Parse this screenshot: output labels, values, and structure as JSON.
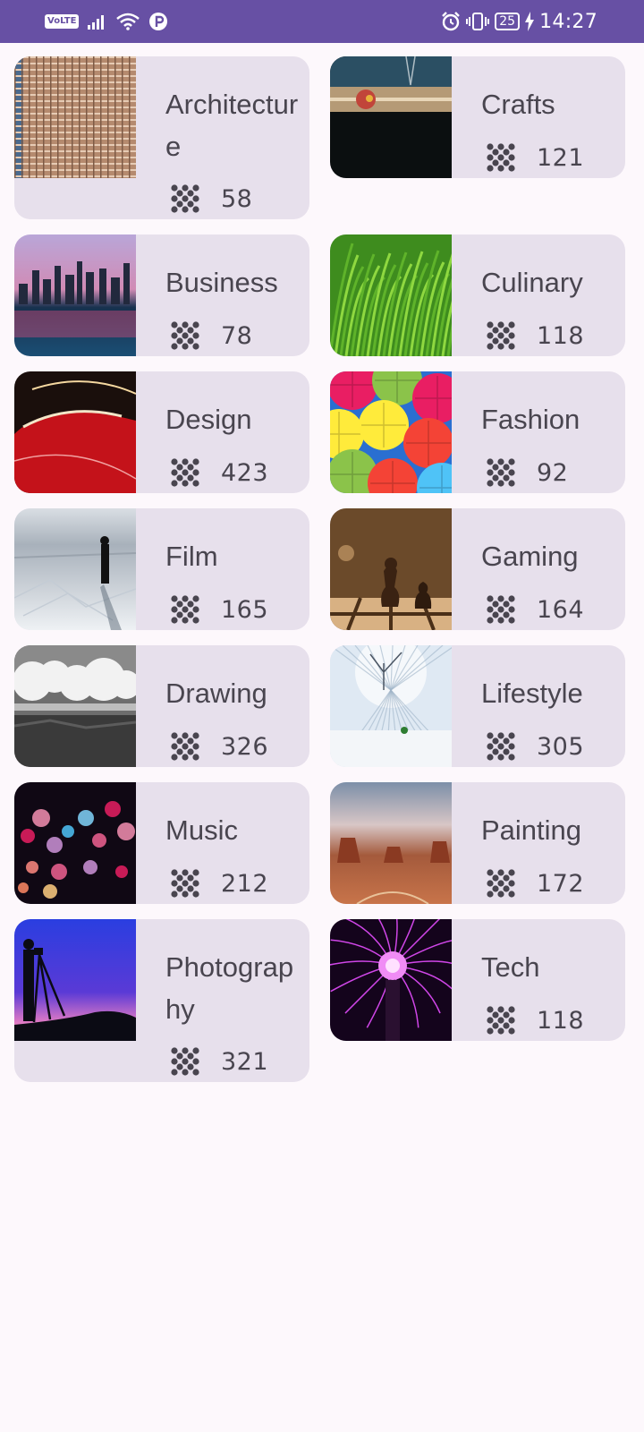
{
  "status_bar": {
    "network_badge": "VoLTE",
    "battery_level": "25",
    "time": "14:27",
    "icons": [
      "signal-icon",
      "wifi-icon",
      "data-saver-icon",
      "alarm-icon",
      "vibrate-icon",
      "battery-icon",
      "charging-icon"
    ]
  },
  "theme": {
    "primary": "#6750A4",
    "card": "#E7E0EC",
    "text": "#49454F",
    "background": "#FDF8FC"
  },
  "categories": [
    {
      "label": "Architecture",
      "count": "58",
      "icon": "dots-grid-icon"
    },
    {
      "label": "Crafts",
      "count": "121",
      "icon": "dots-grid-icon"
    },
    {
      "label": "Business",
      "count": "78",
      "icon": "dots-grid-icon"
    },
    {
      "label": "Culinary",
      "count": "118",
      "icon": "dots-grid-icon"
    },
    {
      "label": "Design",
      "count": "423",
      "icon": "dots-grid-icon"
    },
    {
      "label": "Fashion",
      "count": "92",
      "icon": "dots-grid-icon"
    },
    {
      "label": "Film",
      "count": "165",
      "icon": "dots-grid-icon"
    },
    {
      "label": "Gaming",
      "count": "164",
      "icon": "dots-grid-icon"
    },
    {
      "label": "Drawing",
      "count": "326",
      "icon": "dots-grid-icon"
    },
    {
      "label": "Lifestyle",
      "count": "305",
      "icon": "dots-grid-icon"
    },
    {
      "label": "Music",
      "count": "212",
      "icon": "dots-grid-icon"
    },
    {
      "label": "Painting",
      "count": "172",
      "icon": "dots-grid-icon"
    },
    {
      "label": "Photography",
      "count": "321",
      "icon": "dots-grid-icon"
    },
    {
      "label": "Tech",
      "count": "118",
      "icon": "dots-grid-icon"
    }
  ]
}
